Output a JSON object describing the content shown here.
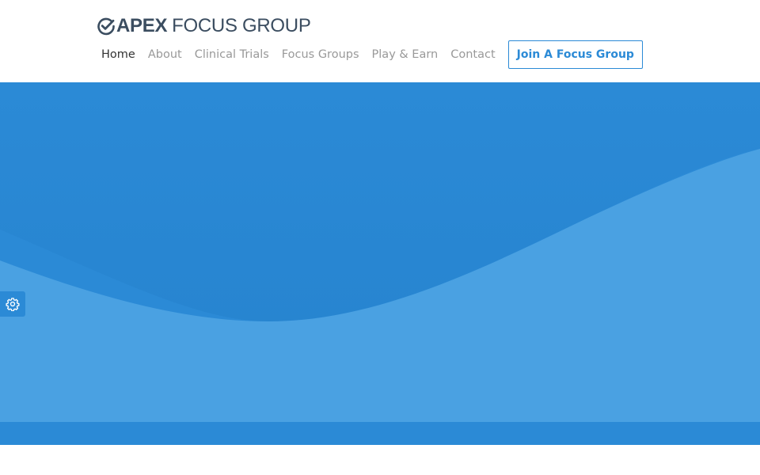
{
  "brand": {
    "name_strong": "APEX",
    "name_light": "FOCUS GROUP",
    "icon": "check-circle-icon"
  },
  "nav": {
    "items": [
      {
        "label": "Home",
        "active": true
      },
      {
        "label": "About",
        "active": false
      },
      {
        "label": "Clinical Trials",
        "active": false
      },
      {
        "label": "Focus Groups",
        "active": false
      },
      {
        "label": "Play & Earn",
        "active": false
      },
      {
        "label": "Contact",
        "active": false
      }
    ],
    "cta_label": "Join A Focus Group"
  },
  "hero": {
    "background": "#2b8ad6",
    "wave_color": "#4aa1e2",
    "shadow_color": "#1f7ac5"
  },
  "settings": {
    "icon": "gear-icon"
  },
  "colors": {
    "accent": "#2b8ad6",
    "brand_text": "#3b4d60",
    "nav_text": "#999999",
    "nav_active": "#333333"
  }
}
